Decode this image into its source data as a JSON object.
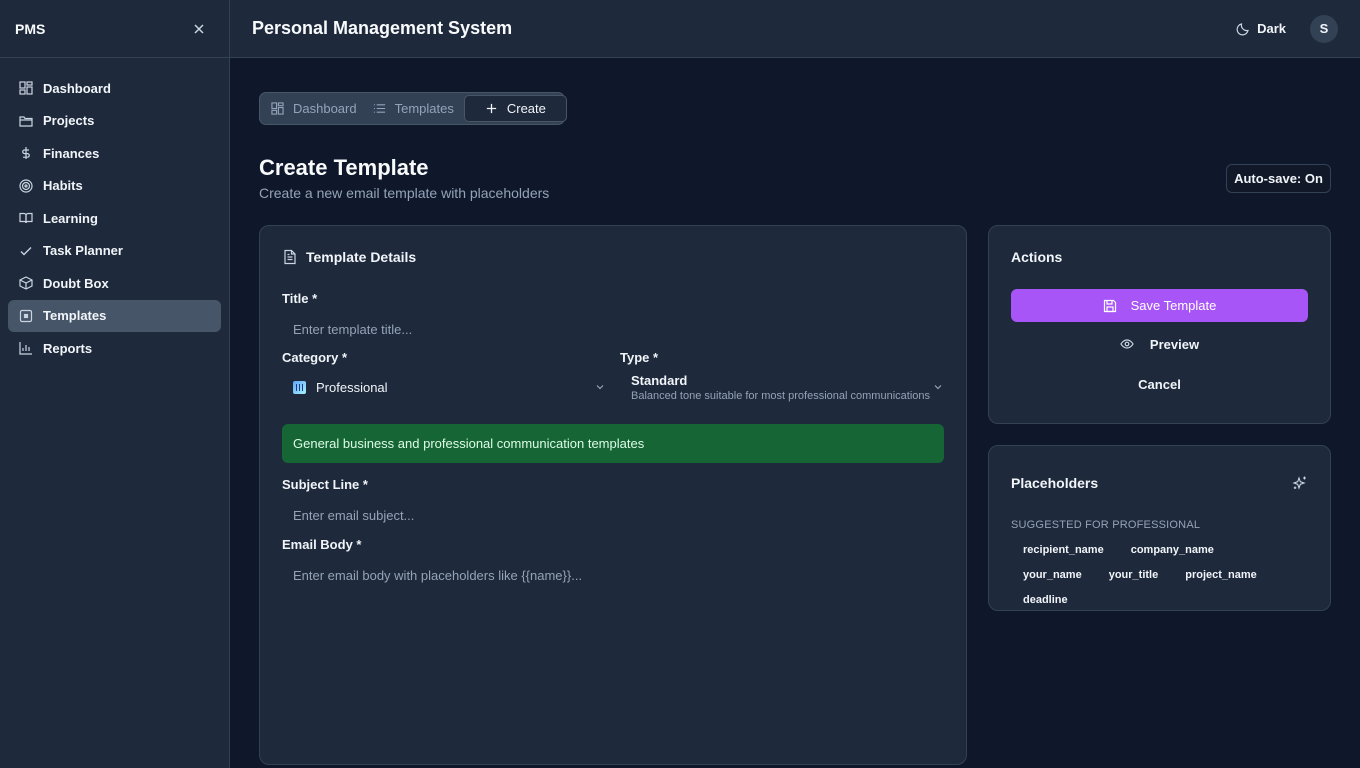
{
  "sidebar": {
    "logo": "PMS",
    "items": [
      {
        "label": "Dashboard",
        "icon": "layout-grid-icon"
      },
      {
        "label": "Projects",
        "icon": "folder-icon"
      },
      {
        "label": "Finances",
        "icon": "dollar-icon"
      },
      {
        "label": "Habits",
        "icon": "target-icon"
      },
      {
        "label": "Learning",
        "icon": "book-icon"
      },
      {
        "label": "Task Planner",
        "icon": "check-icon"
      },
      {
        "label": "Doubt Box",
        "icon": "box-icon"
      },
      {
        "label": "Templates",
        "icon": "template-icon",
        "active": true
      },
      {
        "label": "Reports",
        "icon": "bar-chart-icon"
      }
    ]
  },
  "header": {
    "title": "Personal Management System",
    "theme_label": "Dark",
    "avatar_initial": "S"
  },
  "tabs": [
    {
      "label": "Dashboard"
    },
    {
      "label": "Templates"
    },
    {
      "label": "Create",
      "active": true
    }
  ],
  "page": {
    "title": "Create Template",
    "subtitle": "Create a new email template with placeholders",
    "autosave": "Auto-save: On"
  },
  "details": {
    "heading": "Template Details",
    "title_label": "Title *",
    "title_placeholder": "Enter template title...",
    "category_label": "Category *",
    "category_value": "Professional",
    "type_label": "Type *",
    "type_value": "Standard",
    "type_desc": "Balanced tone suitable for most professional communications",
    "category_info": "General business and professional communication templates",
    "subject_label": "Subject Line *",
    "subject_placeholder": "Enter email subject...",
    "body_label": "Email Body *",
    "body_placeholder": "Enter email body with placeholders like {{name}}..."
  },
  "actions": {
    "heading": "Actions",
    "save": "Save Template",
    "preview": "Preview",
    "cancel": "Cancel"
  },
  "placeholders": {
    "heading": "Placeholders",
    "section": "SUGGESTED FOR PROFESSIONAL",
    "chips": [
      "recipient_name",
      "company_name",
      "your_name",
      "your_title",
      "project_name",
      "deadline"
    ]
  },
  "colors": {
    "background": "#0f172a",
    "panel": "#1e293b",
    "accent": "#a855f7",
    "success_banner": "#166534"
  }
}
